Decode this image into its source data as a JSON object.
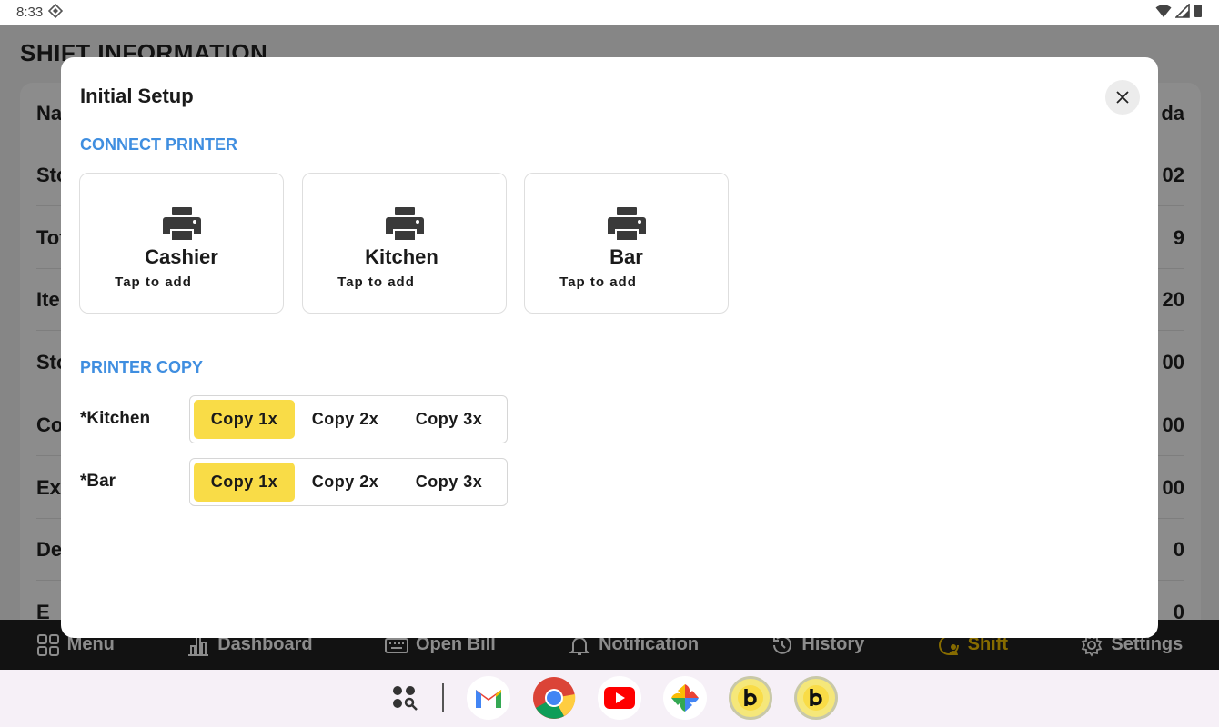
{
  "status_bar": {
    "time": "8:33"
  },
  "app": {
    "page_title": "SHIFT INFORMATION",
    "rows": [
      {
        "label": "Na",
        "value": "da"
      },
      {
        "label": "Sto",
        "value": "02"
      },
      {
        "label": "Tot",
        "value": "9"
      },
      {
        "label": "Ite",
        "value": "20"
      },
      {
        "label": "Sto",
        "value": "00"
      },
      {
        "label": "Co",
        "value": "00"
      },
      {
        "label": "Ex",
        "value": "00"
      },
      {
        "label": "De",
        "value": "0"
      },
      {
        "label": "E",
        "value": "0"
      }
    ],
    "nav": [
      {
        "label": "Menu",
        "icon": "grid-icon"
      },
      {
        "label": "Dashboard",
        "icon": "bar-chart-icon"
      },
      {
        "label": "Open Bill",
        "icon": "keyboard-icon"
      },
      {
        "label": "Notification",
        "icon": "bell-icon"
      },
      {
        "label": "History",
        "icon": "history-icon"
      },
      {
        "label": "Shift",
        "icon": "shift-icon",
        "active": true
      },
      {
        "label": "Settings",
        "icon": "gear-icon"
      }
    ]
  },
  "modal": {
    "title": "Initial Setup",
    "connect_printer_label": "CONNECT PRINTER",
    "printers": [
      {
        "name": "Cashier",
        "hint": "Tap to add"
      },
      {
        "name": "Kitchen",
        "hint": "Tap to add"
      },
      {
        "name": "Bar",
        "hint": "Tap to add"
      }
    ],
    "printer_copy_label": "PRINTER COPY",
    "copy_groups": [
      {
        "label": "*Kitchen",
        "options": [
          "Copy 1x",
          "Copy 2x",
          "Copy 3x"
        ],
        "selected": "Copy 1x"
      },
      {
        "label": "*Bar",
        "options": [
          "Copy 1x",
          "Copy 2x",
          "Copy 3x"
        ],
        "selected": "Copy 1x"
      }
    ]
  },
  "dock": [
    "app-drawer-icon",
    "gmail-icon",
    "chrome-icon",
    "youtube-icon",
    "photos-icon",
    "b-app-icon",
    "b-app-icon"
  ],
  "colors": {
    "accent_blue": "#3f8ee0",
    "selected_yellow": "#f9dc47",
    "nav_active": "#f5c400"
  }
}
